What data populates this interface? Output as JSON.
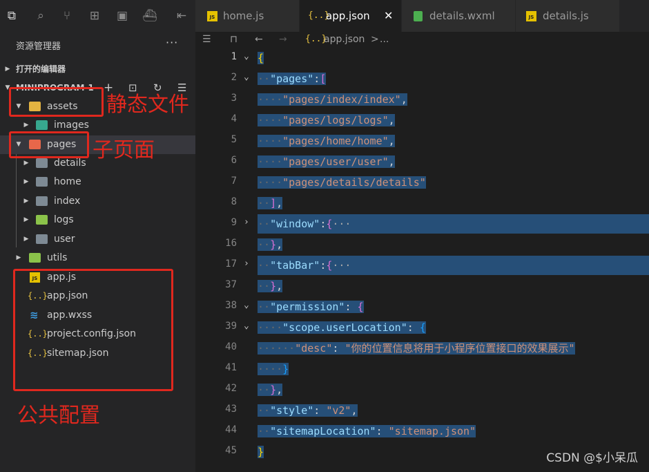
{
  "activity_icons": [
    "files-icon",
    "search-icon",
    "source-control-icon",
    "extensions-icon",
    "save-icon",
    "docker-icon",
    "collapse-icon"
  ],
  "sidebar": {
    "title": "资源管理器",
    "more": "···",
    "open_editors": "打开的编辑器",
    "project": "MINIPROGRAM-1",
    "tree": {
      "assets": "assets",
      "images": "images",
      "pages": "pages",
      "details": "details",
      "home": "home",
      "index": "index",
      "logs": "logs",
      "user": "user",
      "utils": "utils",
      "app_js": "app.js",
      "app_json": "app.json",
      "app_wxss": "app.wxss",
      "project_config": "project.config.json",
      "sitemap": "sitemap.json"
    }
  },
  "annotations": {
    "static_files": "静态文件",
    "sub_pages": "子页面",
    "public_config": "公共配置"
  },
  "tabs": [
    {
      "label": "home.js",
      "icon": "js"
    },
    {
      "label": "app.json",
      "icon": "json",
      "active": true
    },
    {
      "label": "details.wxml",
      "icon": "wxml"
    },
    {
      "label": "details.js",
      "icon": "js"
    }
  ],
  "breadcrumb": {
    "file": "app.json",
    "sep": ">",
    "more": "..."
  },
  "gutter": [
    "1",
    "2",
    "3",
    "4",
    "5",
    "6",
    "7",
    "8",
    "9",
    "16",
    "17",
    "37",
    "38",
    "39",
    "40",
    "41",
    "42",
    "43",
    "44",
    "45"
  ],
  "code": {
    "pages_key": "\"pages\"",
    "page_1": "\"pages/index/index\"",
    "page_2": "\"pages/logs/logs\"",
    "page_3": "\"pages/home/home\"",
    "page_4": "\"pages/user/user\"",
    "page_5": "\"pages/details/details\"",
    "window_key": "\"window\"",
    "tabbar_key": "\"tabBar\"",
    "permission_key": "\"permission\"",
    "scope_key": "\"scope.userLocation\"",
    "desc_key": "\"desc\"",
    "desc_value": "\"你的位置信息将用于小程序位置接口的效果展示\"",
    "style_key": "\"style\"",
    "style_value": "\"v2\"",
    "sitemap_key": "\"sitemapLocation\"",
    "sitemap_value": "\"sitemap.json\"",
    "collapsed": "···"
  },
  "watermark": "CSDN @$小呆瓜",
  "colors": {
    "annotation": "#e0281e",
    "selection": "#264f78",
    "string": "#ce9178",
    "key": "#9cdcfe"
  }
}
